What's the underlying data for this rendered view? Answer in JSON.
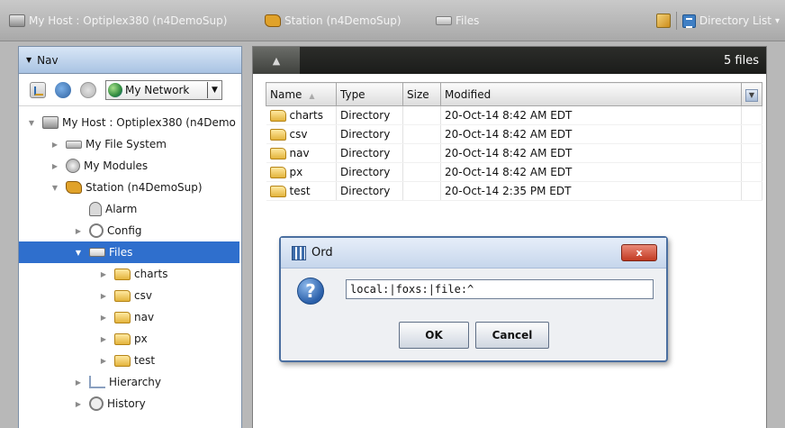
{
  "breadcrumb": {
    "host": "My Host : Optiplex380 (n4DemoSup)",
    "station": "Station (n4DemoSup)",
    "files": "Files"
  },
  "toolbar": {
    "view_select": "Directory List"
  },
  "nav": {
    "title": "Nav",
    "network_select": "My Network",
    "tree": [
      {
        "label": "My Host : Optiplex380 (n4Demo",
        "icon": "host-icon"
      },
      {
        "label": "My File System",
        "icon": "drive-icon"
      },
      {
        "label": "My Modules",
        "icon": "modules-icon"
      },
      {
        "label": "Station (n4DemoSup)",
        "icon": "station-icon"
      },
      {
        "label": "Alarm",
        "icon": "alarm-icon"
      },
      {
        "label": "Config",
        "icon": "config-icon"
      },
      {
        "label": "Files",
        "icon": "files-icon"
      },
      {
        "label": "charts",
        "icon": "folder-icon"
      },
      {
        "label": "csv",
        "icon": "folder-icon"
      },
      {
        "label": "nav",
        "icon": "folder-icon"
      },
      {
        "label": "px",
        "icon": "folder-icon"
      },
      {
        "label": "test",
        "icon": "folder-icon"
      },
      {
        "label": "Hierarchy",
        "icon": "hierarchy-icon"
      },
      {
        "label": "History",
        "icon": "history-icon"
      }
    ],
    "selected_color": "#2f6fcd"
  },
  "files": {
    "count_label": "5 files",
    "columns": [
      "Name",
      "Type",
      "Size",
      "Modified"
    ],
    "rows": [
      {
        "name": "charts",
        "type": "Directory",
        "size": "",
        "modified": "20-Oct-14 8:42 AM EDT"
      },
      {
        "name": "csv",
        "type": "Directory",
        "size": "",
        "modified": "20-Oct-14 8:42 AM EDT"
      },
      {
        "name": "nav",
        "type": "Directory",
        "size": "",
        "modified": "20-Oct-14 8:42 AM EDT"
      },
      {
        "name": "px",
        "type": "Directory",
        "size": "",
        "modified": "20-Oct-14 8:42 AM EDT"
      },
      {
        "name": "test",
        "type": "Directory",
        "size": "",
        "modified": "20-Oct-14 2:35 PM EDT"
      }
    ]
  },
  "dialog": {
    "title": "Ord",
    "value": "local:|foxs:|file:^",
    "ok_label": "OK",
    "cancel_label": "Cancel",
    "close_label": "x"
  }
}
